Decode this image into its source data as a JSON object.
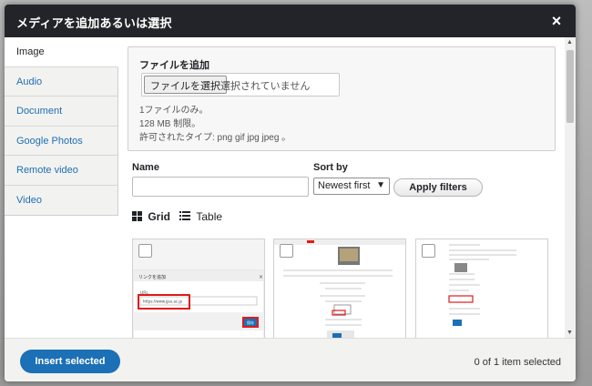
{
  "dialog": {
    "title": "メディアを追加あるいは選択",
    "close_glyph": "×"
  },
  "tabs": [
    {
      "label": "Image",
      "active": true
    },
    {
      "label": "Audio",
      "active": false
    },
    {
      "label": "Document",
      "active": false
    },
    {
      "label": "Google Photos",
      "active": false
    },
    {
      "label": "Remote video",
      "active": false
    },
    {
      "label": "Video",
      "active": false
    }
  ],
  "upload": {
    "label": "ファイルを追加",
    "button": "ファイルを選択",
    "status": "選択されていません",
    "help_1": "1ファイルのみ。",
    "help_2": "128 MB 制限。",
    "help_3": "許可されたタイプ: png gif jpg jpeg 。"
  },
  "filters": {
    "name_label": "Name",
    "name_value": "",
    "sort_label": "Sort by",
    "sort_value": "Newest first",
    "apply_label": "Apply filters"
  },
  "view": {
    "grid_label": "Grid",
    "table_label": "Table"
  },
  "thumb1": {
    "dialog_title": "リンクを追加",
    "url_label": "URL",
    "url_value": "https://www.gsu.ac.jp",
    "save": "保存"
  },
  "footer": {
    "insert_label": "Insert selected",
    "count_text": "0 of 1 item selected"
  },
  "colors": {
    "titlebar": "#232429",
    "accent": "#1b70b6",
    "link": "#1f6fb2",
    "highlight": "#e01b1b"
  }
}
